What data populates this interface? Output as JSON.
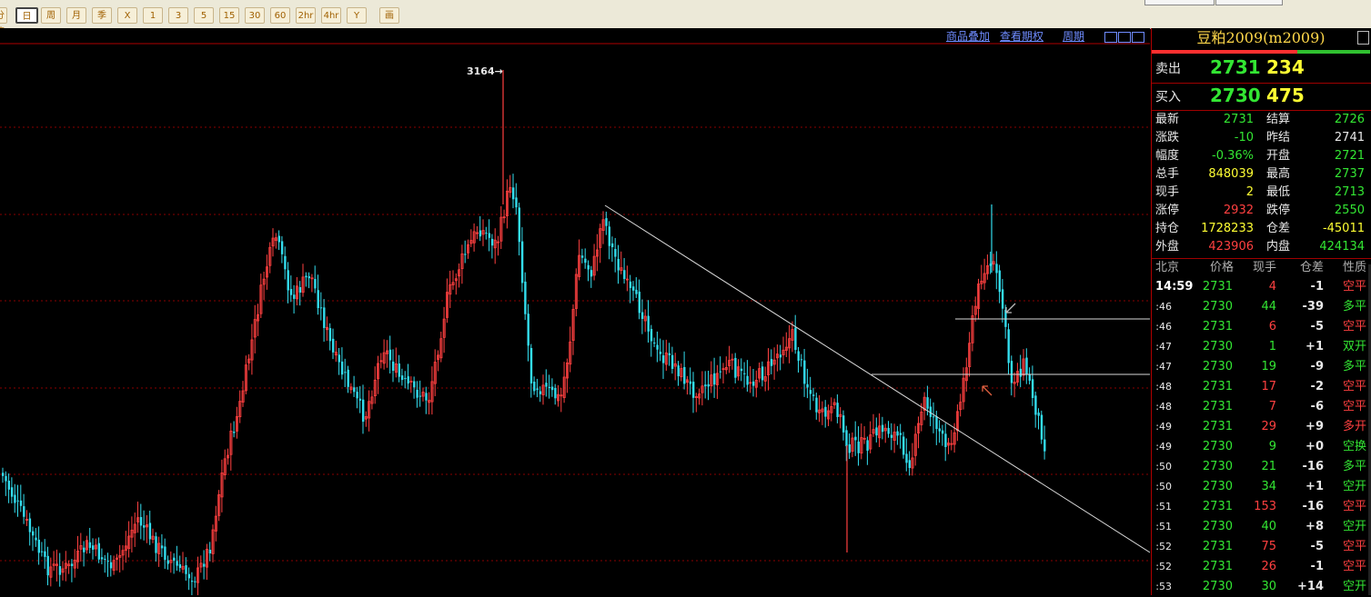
{
  "toolbar": {
    "items": [
      {
        "label": "分笔",
        "selected": false
      },
      {
        "label": "日",
        "selected": true
      },
      {
        "label": "周",
        "selected": false
      },
      {
        "label": "月",
        "selected": false
      },
      {
        "label": "季",
        "selected": false
      },
      {
        "label": "X",
        "selected": false
      },
      {
        "label": "1",
        "selected": false
      },
      {
        "label": "3",
        "selected": false
      },
      {
        "label": "5",
        "selected": false
      },
      {
        "label": "15",
        "selected": false
      },
      {
        "label": "30",
        "selected": false
      },
      {
        "label": "60",
        "selected": false
      },
      {
        "label": "2hr",
        "selected": false
      },
      {
        "label": "4hr",
        "selected": false
      },
      {
        "label": "Y",
        "selected": false
      },
      {
        "label": "画",
        "selected": false
      }
    ]
  },
  "chart": {
    "links": [
      "商品叠加",
      "查看期权",
      "周期"
    ],
    "high_label": "3164→",
    "colors": {
      "up": "#ff4040",
      "down": "#33ddee",
      "grid": "#8a0000",
      "trend": "#d8d8d8"
    }
  },
  "chart_data": {
    "type": "candlestick",
    "price_high_marker": 3164,
    "ylim": [
      2400,
      3250
    ],
    "notes": "Daily K-line of 豆粕2009 with descending trendline and two horizontal lines"
  },
  "panel": {
    "title": "豆粕2009(m2009)",
    "colors": {
      "red": "#ff4040",
      "green": "#33e633",
      "yellow": "#ffff33",
      "white": "#e8e8e8"
    },
    "ask": {
      "label": "卖出",
      "price": "2731",
      "vol": "234"
    },
    "bid": {
      "label": "买入",
      "price": "2730",
      "vol": "475"
    },
    "stats": [
      {
        "l1": "最新",
        "v1": "2731",
        "c1": "green",
        "l2": "结算",
        "v2": "2726",
        "c2": "green"
      },
      {
        "l1": "涨跌",
        "v1": "-10",
        "c1": "green",
        "l2": "昨结",
        "v2": "2741",
        "c2": "white"
      },
      {
        "l1": "幅度",
        "v1": "-0.36%",
        "c1": "green",
        "l2": "开盘",
        "v2": "2721",
        "c2": "green"
      },
      {
        "l1": "总手",
        "v1": "848039",
        "c1": "yellow",
        "l2": "最高",
        "v2": "2737",
        "c2": "green"
      },
      {
        "l1": "现手",
        "v1": "2",
        "c1": "yellow",
        "l2": "最低",
        "v2": "2713",
        "c2": "green"
      },
      {
        "l1": "涨停",
        "v1": "2932",
        "c1": "red",
        "l2": "跌停",
        "v2": "2550",
        "c2": "green"
      },
      {
        "l1": "持仓",
        "v1": "1728233",
        "c1": "yellow",
        "l2": "仓差",
        "v2": "-45011",
        "c2": "yellow"
      },
      {
        "l1": "外盘",
        "v1": "423906",
        "c1": "red",
        "l2": "内盘",
        "v2": "424134",
        "c2": "green"
      }
    ],
    "ticks_header": [
      "北京",
      "价格",
      "现手",
      "仓差",
      "性质"
    ],
    "ticks": [
      {
        "time": "14:59",
        "price": "2731",
        "pc": "green",
        "vol": "4",
        "vc": "red",
        "oi": "-1",
        "nature": "空平",
        "nc": "red"
      },
      {
        "time": ":46",
        "price": "2730",
        "pc": "green",
        "vol": "44",
        "vc": "green",
        "oi": "-39",
        "nature": "多平",
        "nc": "green"
      },
      {
        "time": ":46",
        "price": "2731",
        "pc": "green",
        "vol": "6",
        "vc": "red",
        "oi": "-5",
        "nature": "空平",
        "nc": "red"
      },
      {
        "time": ":47",
        "price": "2730",
        "pc": "green",
        "vol": "1",
        "vc": "green",
        "oi": "+1",
        "nature": "双开",
        "nc": "green"
      },
      {
        "time": ":47",
        "price": "2730",
        "pc": "green",
        "vol": "19",
        "vc": "green",
        "oi": "-9",
        "nature": "多平",
        "nc": "green"
      },
      {
        "time": ":48",
        "price": "2731",
        "pc": "green",
        "vol": "17",
        "vc": "red",
        "oi": "-2",
        "nature": "空平",
        "nc": "red"
      },
      {
        "time": ":48",
        "price": "2731",
        "pc": "green",
        "vol": "7",
        "vc": "red",
        "oi": "-6",
        "nature": "空平",
        "nc": "red"
      },
      {
        "time": ":49",
        "price": "2731",
        "pc": "green",
        "vol": "29",
        "vc": "red",
        "oi": "+9",
        "nature": "多开",
        "nc": "red"
      },
      {
        "time": ":49",
        "price": "2730",
        "pc": "green",
        "vol": "9",
        "vc": "green",
        "oi": "+0",
        "nature": "空换",
        "nc": "green"
      },
      {
        "time": ":50",
        "price": "2730",
        "pc": "green",
        "vol": "21",
        "vc": "green",
        "oi": "-16",
        "nature": "多平",
        "nc": "green"
      },
      {
        "time": ":50",
        "price": "2730",
        "pc": "green",
        "vol": "34",
        "vc": "green",
        "oi": "+1",
        "nature": "空开",
        "nc": "green"
      },
      {
        "time": ":51",
        "price": "2731",
        "pc": "green",
        "vol": "153",
        "vc": "red",
        "oi": "-16",
        "nature": "空平",
        "nc": "red"
      },
      {
        "time": ":51",
        "price": "2730",
        "pc": "green",
        "vol": "40",
        "vc": "green",
        "oi": "+8",
        "nature": "空开",
        "nc": "green"
      },
      {
        "time": ":52",
        "price": "2731",
        "pc": "green",
        "vol": "75",
        "vc": "red",
        "oi": "-5",
        "nature": "空平",
        "nc": "red"
      },
      {
        "time": ":52",
        "price": "2731",
        "pc": "green",
        "vol": "26",
        "vc": "red",
        "oi": "-1",
        "nature": "空平",
        "nc": "red"
      },
      {
        "time": ":53",
        "price": "2730",
        "pc": "green",
        "vol": "30",
        "vc": "green",
        "oi": "+14",
        "nature": "空开",
        "nc": "green"
      }
    ]
  }
}
